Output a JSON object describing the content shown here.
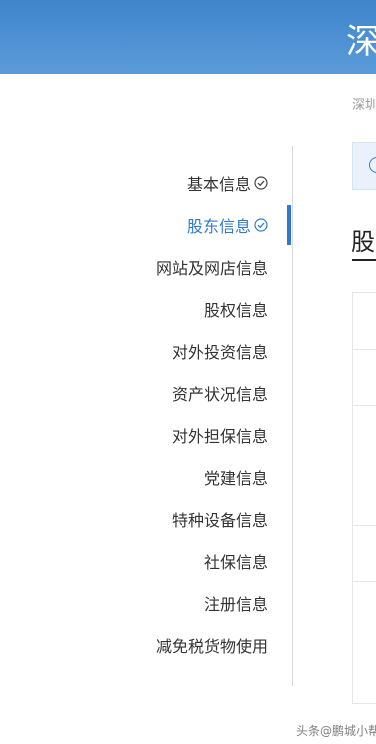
{
  "header": {
    "title": "深"
  },
  "breadcrumb": {
    "text": "深圳"
  },
  "sidebar": {
    "items": [
      {
        "label": "基本信息",
        "checked": true,
        "active": false
      },
      {
        "label": "股东信息",
        "checked": true,
        "active": true
      },
      {
        "label": "网站及网店信息",
        "checked": false,
        "active": false
      },
      {
        "label": "股权信息",
        "checked": false,
        "active": false
      },
      {
        "label": "对外投资信息",
        "checked": false,
        "active": false
      },
      {
        "label": "资产状况信息",
        "checked": false,
        "active": false
      },
      {
        "label": "对外担保信息",
        "checked": false,
        "active": false
      },
      {
        "label": "党建信息",
        "checked": false,
        "active": false
      },
      {
        "label": "特种设备信息",
        "checked": false,
        "active": false
      },
      {
        "label": "社保信息",
        "checked": false,
        "active": false
      },
      {
        "label": "注册信息",
        "checked": false,
        "active": false
      },
      {
        "label": "减免税货物使用",
        "checked": false,
        "active": false
      }
    ]
  },
  "main": {
    "section_title": "股"
  },
  "watermark": {
    "text": "头条@鹏城小帮手"
  },
  "colors": {
    "header": "#4a8fd2",
    "accent": "#2f7ad0"
  }
}
